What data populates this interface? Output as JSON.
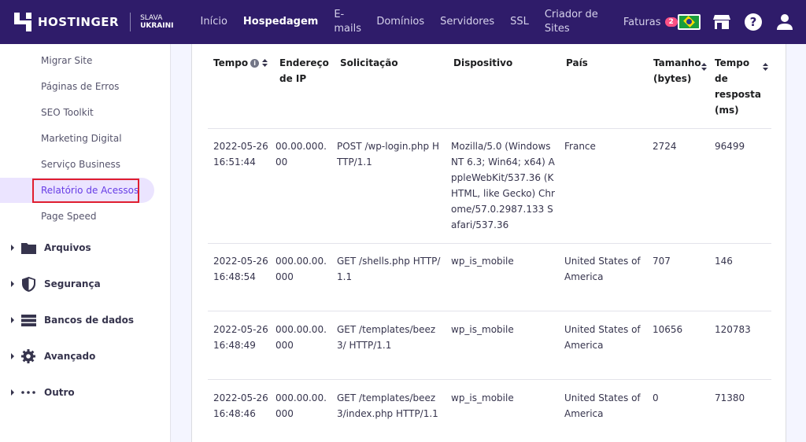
{
  "topbar": {
    "brand": "HOSTINGER",
    "slava_line1": "SLAVA",
    "slava_line2": "UKRAINI",
    "nav": [
      {
        "label": "Início"
      },
      {
        "label": "Hospedagem"
      },
      {
        "label": "E-mails"
      },
      {
        "label": "Domínios"
      },
      {
        "label": "Servidores"
      },
      {
        "label": "SSL"
      },
      {
        "label": "Criador de Sites"
      }
    ],
    "faturas_label": "Faturas",
    "faturas_count": "2",
    "icons": [
      "brazil-flag-icon",
      "store-icon",
      "help-icon",
      "user-icon"
    ]
  },
  "sidebar": {
    "sub_items": [
      "Migrar Site",
      "Páginas de Erros",
      "SEO Toolkit",
      "Marketing Digital",
      "Serviço Business",
      "Relatório de Acessos",
      "Page Speed"
    ],
    "active_item": "Relatório de Acessos",
    "groups": [
      {
        "label": "Arquivos",
        "icon": "folder-icon"
      },
      {
        "label": "Segurança",
        "icon": "shield-icon"
      },
      {
        "label": "Bancos de dados",
        "icon": "database-icon"
      },
      {
        "label": "Avançado",
        "icon": "gear-icon"
      },
      {
        "label": "Outro",
        "icon": "more-icon"
      }
    ]
  },
  "table": {
    "headers": {
      "tempo": "Tempo",
      "ip": "Endereço de IP",
      "request": "Solicitação",
      "device": "Dispositivo",
      "country": "País",
      "size": "Tamanho (bytes)",
      "response": "Tempo de resposta (ms)"
    },
    "rows": [
      {
        "time": "2022-05-26 16:51:44",
        "ip": "00.00.000.00",
        "request": "POST /wp-login.php HTTP/1.1",
        "device": "Mozilla/5.0 (Windows NT 6.3; Win64; x64) AppleWebKit/537.36 (KHTML, like Gecko) Chrome/57.0.2987.133 Safari/537.36",
        "country": "France",
        "size": "2724",
        "response": "96499"
      },
      {
        "time": "2022-05-26 16:48:54",
        "ip": "000.00.00.000",
        "request": "GET /shells.php HTTP/1.1",
        "device": "wp_is_mobile",
        "country": "United States of America",
        "size": "707",
        "response": "146"
      },
      {
        "time": "2022-05-26 16:48:49",
        "ip": "000.00.00.000",
        "request": "GET /templates/beez3/ HTTP/1.1",
        "device": "wp_is_mobile",
        "country": "United States of America",
        "size": "10656",
        "response": "120783"
      },
      {
        "time": "2022-05-26 16:48:46",
        "ip": "000.00.00.000",
        "request": "GET /templates/beez3/index.php HTTP/1.1",
        "device": "wp_is_mobile",
        "country": "United States of America",
        "size": "0",
        "response": "71380"
      }
    ]
  }
}
